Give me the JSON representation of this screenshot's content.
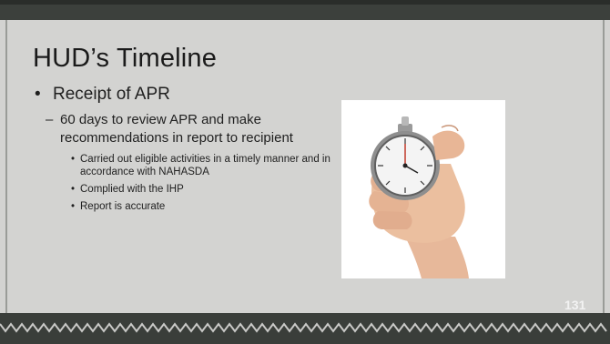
{
  "slide": {
    "title": "HUD’s Timeline",
    "slide_number": "131",
    "bullets": {
      "level1": "Receipt of APR",
      "level2": "60 days to review APR and make recommendations in report to recipient",
      "level3": [
        "Carried out eligible activities in a timely manner and in accordance with NAHASDA",
        "Complied with the IHP",
        "Report is accurate"
      ]
    },
    "image": {
      "icon": "stopwatch-in-hand-icon"
    }
  },
  "colors": {
    "background": "#d3d3d1",
    "band": "#3a3e3a",
    "text": "#1f1f1f"
  }
}
